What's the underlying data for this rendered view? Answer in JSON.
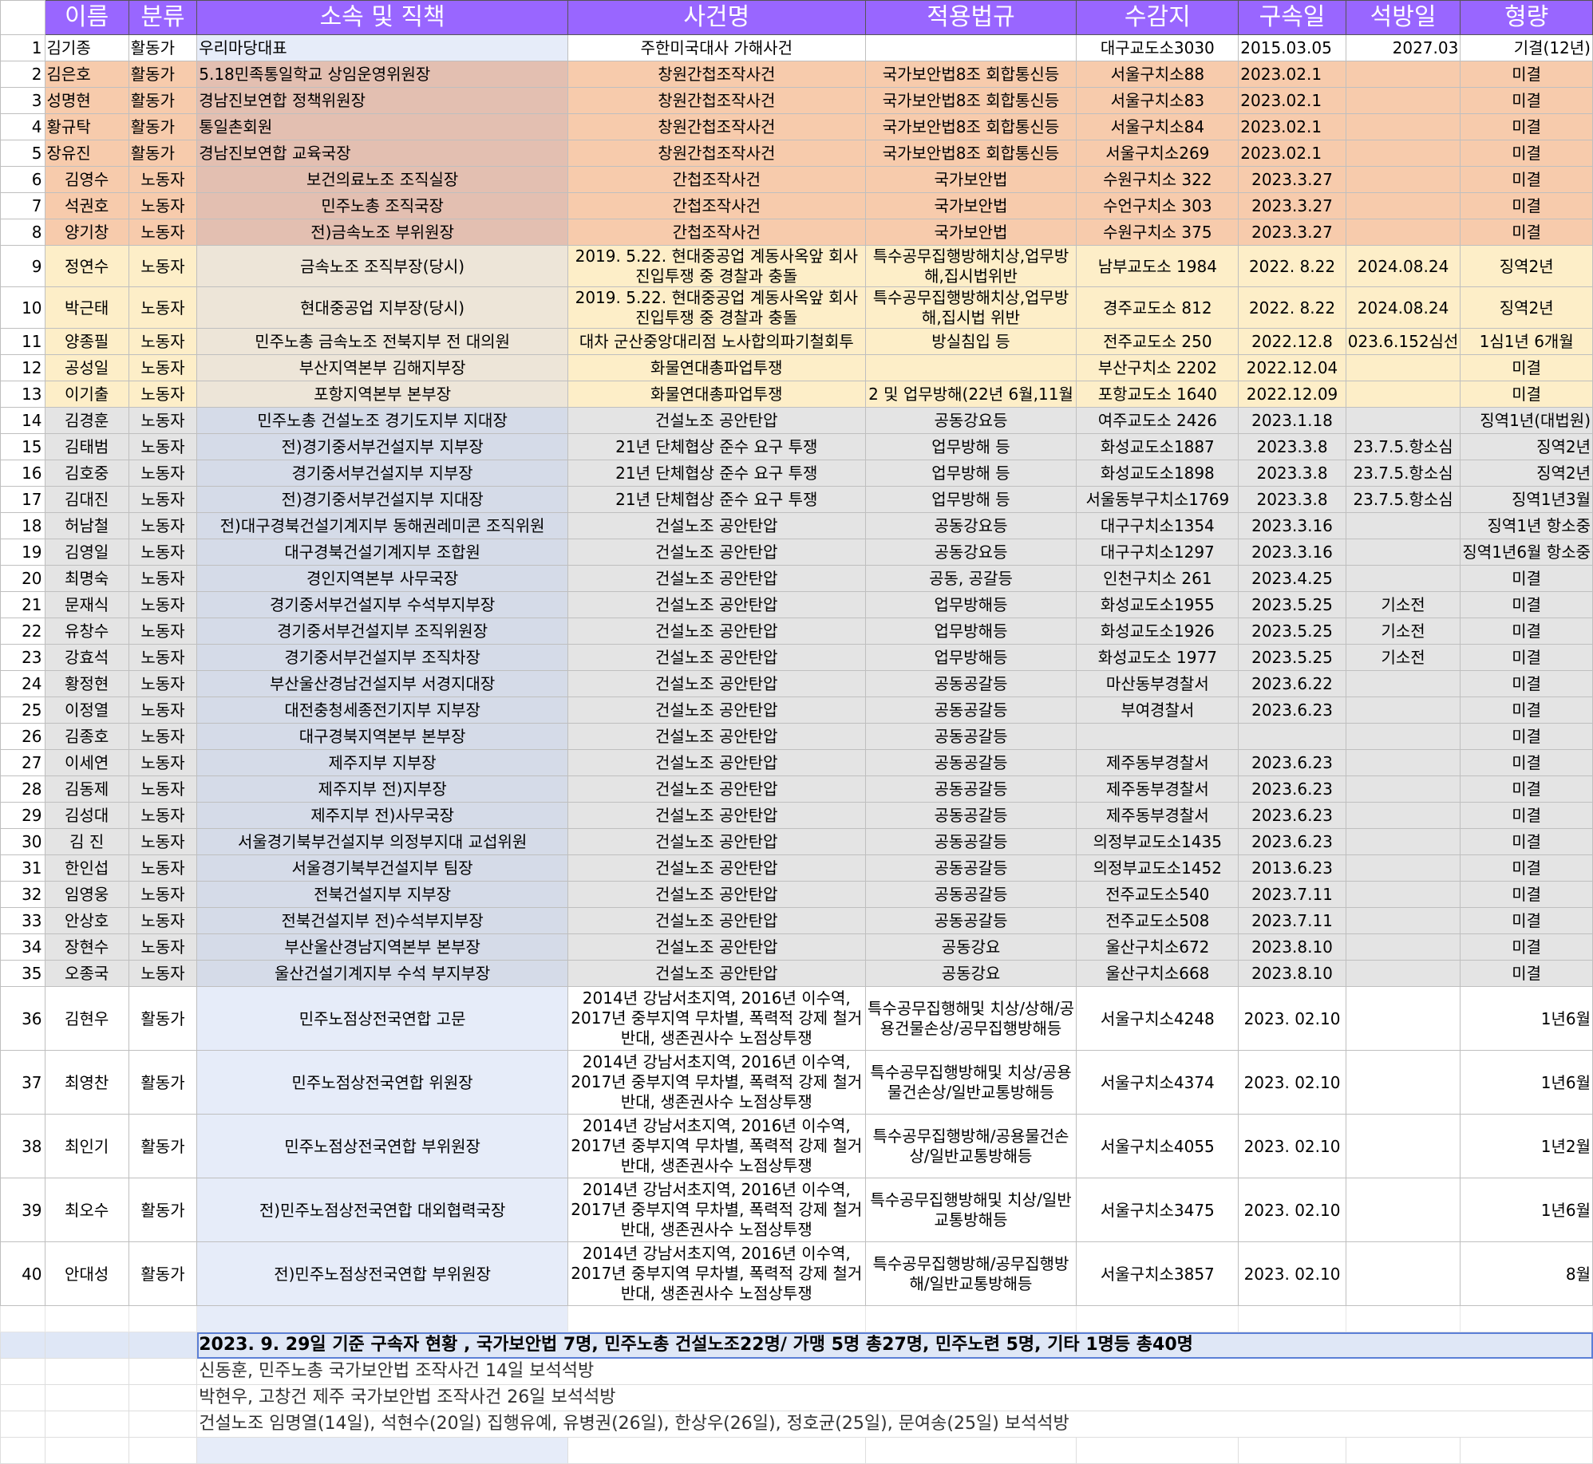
{
  "headers": [
    "이름",
    "분류",
    "소속 및 직책",
    "사건명",
    "적용법규",
    "수감지",
    "구속일",
    "석방일",
    "형량"
  ],
  "rows": [
    {
      "n": "1",
      "name": "김기종",
      "cat": "활동가",
      "org": "우리마당대표",
      "case": "주한미국대사 가해사건",
      "law": "",
      "prison": "대구교도소3030",
      "arrest": "2015.03.05",
      "release": "2027.03",
      "sentence": "기결(12년)"
    },
    {
      "n": "2",
      "name": "김은호",
      "cat": "활동가",
      "org": "5.18민족통일학교 상임운영위원장",
      "case": "창원간첩조작사건",
      "law": "국가보안법8조 회합통신등",
      "prison": "서울구치소88",
      "arrest": "2023.02.1",
      "release": "",
      "sentence": "미결"
    },
    {
      "n": "3",
      "name": "성명현",
      "cat": "활동가",
      "org": "경남진보연합 정책위원장",
      "case": "창원간첩조작사건",
      "law": "국가보안법8조 회합통신등",
      "prison": "서울구치소83",
      "arrest": "2023.02.1",
      "release": "",
      "sentence": "미결"
    },
    {
      "n": "4",
      "name": "황규탁",
      "cat": "활동가",
      "org": "통일촌회원",
      "case": "창원간첩조작사건",
      "law": "국가보안법8조 회합통신등",
      "prison": "서울구치소84",
      "arrest": "2023.02.1",
      "release": "",
      "sentence": "미결"
    },
    {
      "n": "5",
      "name": "장유진",
      "cat": "활동가",
      "org": "경남진보연합 교육국장",
      "case": "창원간첩조작사건",
      "law": "국가보안법8조 회합통신등",
      "prison": "서울구치소269",
      "arrest": "2023.02.1",
      "release": "",
      "sentence": "미결"
    },
    {
      "n": "6",
      "name": "김영수",
      "cat": "노동자",
      "org": "보건의료노조 조직실장",
      "case": "간첩조작사건",
      "law": "국가보안법",
      "prison": "수원구치소 322",
      "arrest": "2023.3.27",
      "release": "",
      "sentence": "미결"
    },
    {
      "n": "7",
      "name": "석권호",
      "cat": "노동자",
      "org": "민주노총 조직국장",
      "case": "간첩조작사건",
      "law": "국가보안법",
      "prison": "수언구치소 303",
      "arrest": "2023.3.27",
      "release": "",
      "sentence": "미결"
    },
    {
      "n": "8",
      "name": "양기창",
      "cat": "노동자",
      "org": "전)금속노조 부위원장",
      "case": "간첩조작사건",
      "law": "국가보안법",
      "prison": "수원구치소 375",
      "arrest": "2023.3.27",
      "release": "",
      "sentence": "미결"
    },
    {
      "n": "9",
      "name": "정연수",
      "cat": "노동자",
      "org": "금속노조 조직부장(당시)",
      "case": "2019. 5.22. 현대중공업 계동사옥앞 회사진입투쟁 중 경찰과 충돌",
      "law": "특수공무집행방해치상,업무방해,집시법위반",
      "prison": "남부교도소 1984",
      "arrest": "2022. 8.22",
      "release": "2024.08.24",
      "sentence": "징역2년"
    },
    {
      "n": "10",
      "name": "박근태",
      "cat": "노동자",
      "org": "현대중공업 지부장(당시)",
      "case": "2019. 5.22. 현대중공업 계동사옥앞 회사진입투쟁 중 경찰과 충돌",
      "law": "특수공무집행방해치상,업무방해,집시법 위반",
      "prison": "경주교도소 812",
      "arrest": "2022. 8.22",
      "release": "2024.08.24",
      "sentence": "징역2년"
    },
    {
      "n": "11",
      "name": "양종필",
      "cat": "노동자",
      "org": "민주노총 금속노조 전북지부 전 대의원",
      "case": "대차 군산중앙대리점 노사합의파기철회투",
      "law": "방실침입 등",
      "prison": "전주교도소 250",
      "arrest": "2022.12.8",
      "release": "023.6.152심선",
      "sentence": "1심1년 6개월"
    },
    {
      "n": "12",
      "name": "공성일",
      "cat": "노동자",
      "org": "부산지역본부 김해지부장",
      "case": "화물연대총파업투쟁",
      "law": "",
      "prison": "부산구치소 2202",
      "arrest": "2022.12.04",
      "release": "",
      "sentence": "미결"
    },
    {
      "n": "13",
      "name": "이기출",
      "cat": "노동자",
      "org": "포항지역본부 본부장",
      "case": "화물연대총파업투쟁",
      "law": "2 및 업무방해(22년 6월,11월",
      "prison": "포항교도소 1640",
      "arrest": "2022.12.09",
      "release": "",
      "sentence": "미결"
    },
    {
      "n": "14",
      "name": "김경훈",
      "cat": "노동자",
      "org": "민주노총 건설노조 경기도지부 지대장",
      "case": "건설노조 공안탄압",
      "law": "공동강요등",
      "prison": "여주교도소 2426",
      "arrest": "2023.1.18",
      "release": "",
      "sentence": "징역1년(대법원)"
    },
    {
      "n": "15",
      "name": "김태범",
      "cat": "노동자",
      "org": "전)경기중서부건설지부 지부장",
      "case": "21년 단체협상 준수 요구 투쟁",
      "law": "업무방해 등",
      "prison": "화성교도소1887",
      "arrest": "2023.3.8",
      "release": "23.7.5.항소심",
      "sentence": "징역2년"
    },
    {
      "n": "16",
      "name": "김호중",
      "cat": "노동자",
      "org": "경기중서부건설지부 지부장",
      "case": "21년 단체협상 준수 요구 투쟁",
      "law": "업무방해 등",
      "prison": "화성교도소1898",
      "arrest": "2023.3.8",
      "release": "23.7.5.항소심",
      "sentence": "징역2년"
    },
    {
      "n": "17",
      "name": "김대진",
      "cat": "노동자",
      "org": "전)경기중서부건설지부 지대장",
      "case": "21년 단체협상 준수 요구 투쟁",
      "law": "업무방해 등",
      "prison": "서울동부구치소1769",
      "arrest": "2023.3.8",
      "release": "23.7.5.항소심",
      "sentence": "징역1년3월"
    },
    {
      "n": "18",
      "name": "허남철",
      "cat": "노동자",
      "org": "전)대구경북건설기계지부 동해권레미콘 조직위원",
      "case": "건설노조 공안탄압",
      "law": "공동강요등",
      "prison": "대구구치소1354",
      "arrest": "2023.3.16",
      "release": "",
      "sentence": "징역1년 항소중"
    },
    {
      "n": "19",
      "name": "김영일",
      "cat": "노동자",
      "org": "대구경북건설기계지부 조합원",
      "case": "건설노조 공안탄압",
      "law": "공동강요등",
      "prison": "대구구치소1297",
      "arrest": "2023.3.16",
      "release": "",
      "sentence": "징역1년6월 항소중"
    },
    {
      "n": "20",
      "name": "최명숙",
      "cat": "노동자",
      "org": "경인지역본부 사무국장",
      "case": "건설노조 공안탄압",
      "law": "공동, 공갈등",
      "prison": "인천구치소 261",
      "arrest": "2023.4.25",
      "release": "",
      "sentence": "미결"
    },
    {
      "n": "21",
      "name": "문재식",
      "cat": "노동자",
      "org": "경기중서부건설지부 수석부지부장",
      "case": "건설노조 공안탄압",
      "law": "업무방해등",
      "prison": "화성교도소1955",
      "arrest": "2023.5.25",
      "release": "기소전",
      "sentence": "미결"
    },
    {
      "n": "22",
      "name": "유창수",
      "cat": "노동자",
      "org": "경기중서부건설지부 조직위원장",
      "case": "건설노조 공안탄압",
      "law": "업무방해등",
      "prison": "화성교도소1926",
      "arrest": "2023.5.25",
      "release": "기소전",
      "sentence": "미결"
    },
    {
      "n": "23",
      "name": "강효석",
      "cat": "노동자",
      "org": "경기중서부건설지부 조직차장",
      "case": "건설노조 공안탄압",
      "law": "업무방해등",
      "prison": "화성교도소 1977",
      "arrest": "2023.5.25",
      "release": "기소전",
      "sentence": "미결"
    },
    {
      "n": "24",
      "name": "황정현",
      "cat": "노동자",
      "org": "부산울산경남건설지부 서경지대장",
      "case": "건설노조 공안탄압",
      "law": "공동공갈등",
      "prison": "마산동부경찰서",
      "arrest": "2023.6.22",
      "release": "",
      "sentence": "미결"
    },
    {
      "n": "25",
      "name": "이정열",
      "cat": "노동자",
      "org": "대전충청세종전기지부 지부장",
      "case": "건설노조 공안탄압",
      "law": "공동공갈등",
      "prison": "부여경찰서",
      "arrest": "2023.6.23",
      "release": "",
      "sentence": "미결"
    },
    {
      "n": "26",
      "name": "김종호",
      "cat": "노동자",
      "org": "대구경북지역본부 본부장",
      "case": "건설노조 공안탄압",
      "law": "공동공갈등",
      "prison": "",
      "arrest": "",
      "release": "",
      "sentence": "미결"
    },
    {
      "n": "27",
      "name": "이세연",
      "cat": "노동자",
      "org": "제주지부 지부장",
      "case": "건설노조 공안탄압",
      "law": "공동공갈등",
      "prison": "제주동부경찰서",
      "arrest": "2023.6.23",
      "release": "",
      "sentence": "미결"
    },
    {
      "n": "28",
      "name": "김동제",
      "cat": "노동자",
      "org": "제주지부 전)지부장",
      "case": "건설노조 공안탄압",
      "law": "공동공갈등",
      "prison": "제주동부경찰서",
      "arrest": "2023.6.23",
      "release": "",
      "sentence": "미결"
    },
    {
      "n": "29",
      "name": "김성대",
      "cat": "노동자",
      "org": "제주지부 전)사무국장",
      "case": "건설노조 공안탄압",
      "law": "공동공갈등",
      "prison": "제주동부경찰서",
      "arrest": "2023.6.23",
      "release": "",
      "sentence": "미결"
    },
    {
      "n": "30",
      "name": "김 진",
      "cat": "노동자",
      "org": "서울경기북부건설지부 의정부지대 교섭위원",
      "case": "건설노조 공안탄압",
      "law": "공동공갈등",
      "prison": "의정부교도소1435",
      "arrest": "2023.6.23",
      "release": "",
      "sentence": "미결"
    },
    {
      "n": "31",
      "name": "한인섭",
      "cat": "노동자",
      "org": "서울경기북부건설지부 팀장",
      "case": "건설노조 공안탄압",
      "law": "공동공갈등",
      "prison": "의정부교도소1452",
      "arrest": "2013.6.23",
      "release": "",
      "sentence": "미결"
    },
    {
      "n": "32",
      "name": "임영웅",
      "cat": "노동자",
      "org": "전북건설지부 지부장",
      "case": "건설노조 공안탄압",
      "law": "공동공갈등",
      "prison": "전주교도소540",
      "arrest": "2023.7.11",
      "release": "",
      "sentence": "미결"
    },
    {
      "n": "33",
      "name": "안상호",
      "cat": "노동자",
      "org": "전북건설지부 전)수석부지부장",
      "case": "건설노조 공안탄압",
      "law": "공동공갈등",
      "prison": "전주교도소508",
      "arrest": "2023.7.11",
      "release": "",
      "sentence": "미결"
    },
    {
      "n": "34",
      "name": "장현수",
      "cat": "노동자",
      "org": "부산울산경남지역본부 본부장",
      "case": "건설노조 공안탄압",
      "law": "공동강요",
      "prison": "울산구치소672",
      "arrest": "2023.8.10",
      "release": "",
      "sentence": "미결"
    },
    {
      "n": "35",
      "name": "오종국",
      "cat": "노동자",
      "org": "울산건설기계지부 수석 부지부장",
      "case": "건설노조 공안탄압",
      "law": "공동강요",
      "prison": "울산구치소668",
      "arrest": "2023.8.10",
      "release": "",
      "sentence": "미결"
    },
    {
      "n": "36",
      "name": "김현우",
      "cat": "활동가",
      "org": "민주노점상전국연합 고문",
      "case": "2014년 강남서초지역, 2016년 이수역, 2017년 중부지역 무차별, 폭력적 강제 철거 반대, 생존권사수 노점상투쟁",
      "law": "특수공무집행해및 치상/상해/공용건물손상/공무집행방해등",
      "prison": "서울구치소4248",
      "arrest": "2023. 02.10",
      "release": "",
      "sentence": "1년6월"
    },
    {
      "n": "37",
      "name": "최영찬",
      "cat": "활동가",
      "org": "민주노점상전국연합 위원장",
      "case": "2014년 강남서초지역, 2016년 이수역, 2017년 중부지역 무차별, 폭력적 강제 철거 반대, 생존권사수 노점상투쟁",
      "law": "특수공무집행방해및 치상/공용물건손상/일반교통방해등",
      "prison": "서울구치소4374",
      "arrest": "2023. 02.10",
      "release": "",
      "sentence": "1년6월"
    },
    {
      "n": "38",
      "name": "최인기",
      "cat": "활동가",
      "org": "민주노점상전국연합 부위원장",
      "case": "2014년 강남서초지역, 2016년 이수역, 2017년 중부지역 무차별, 폭력적 강제 철거 반대, 생존권사수 노점상투쟁",
      "law": "특수공무집행방해/공용물건손상/일반교통방해등",
      "prison": "서울구치소4055",
      "arrest": "2023. 02.10",
      "release": "",
      "sentence": "1년2월"
    },
    {
      "n": "39",
      "name": "최오수",
      "cat": "활동가",
      "org": "전)민주노점상전국연합 대외협력국장",
      "case": "2014년 강남서초지역, 2016년 이수역, 2017년 중부지역 무차별, 폭력적 강제 철거 반대, 생존권사수 노점상투쟁",
      "law": "특수공무집행방해및 치상/일반교통방해등",
      "prison": "서울구치소3475",
      "arrest": "2023. 02.10",
      "release": "",
      "sentence": "1년6월"
    },
    {
      "n": "40",
      "name": "안대성",
      "cat": "활동가",
      "org": "전)민주노점상전국연합 부위원장",
      "case": "2014년 강남서초지역, 2016년 이수역, 2017년 중부지역 무차별, 폭력적 강제 철거 반대, 생존권사수 노점상투쟁",
      "law": "특수공무집행방해/공무집행방해/일반교통방해등",
      "prison": "서울구치소3857",
      "arrest": "2023. 02.10",
      "release": "",
      "sentence": "8월"
    }
  ],
  "summary": "2023. 9. 29일 기준 구속자 현황 , 국가보안법 7명, 민주노총 건설노조22명/ 가맹 5명 총27명, 민주노련 5명, 기타 1명등 총40명",
  "notes": [
    "신동훈, 민주노총 국가보안법 조작사건 14일 보석석방",
    "박현우, 고창건 제주 국가보안법 조작사건 26일 보석석방",
    "건설노조 임명열(14일), 석현수(20일) 집행유예, 유병권(26일), 한상우(26일), 정호균(25일), 문여송(25일) 보석석방"
  ],
  "colors": {
    "header": "#9966ff",
    "salmon": "#f7cbac",
    "beige": "#fdeec8",
    "gray": "#e4e4e4",
    "orgBlue": "#e6ecf9"
  }
}
